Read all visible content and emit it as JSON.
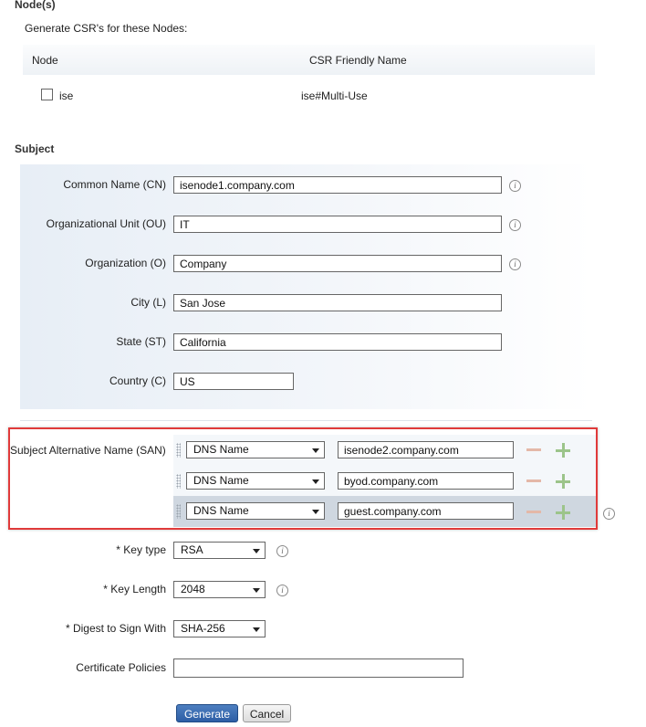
{
  "nodes": {
    "title": "Node(s)",
    "subtitle": "Generate CSR's for these Nodes:",
    "columns": [
      "Node",
      "CSR Friendly Name"
    ],
    "rows": [
      {
        "node": "ise",
        "friendly_name": "ise#Multi-Use",
        "checked": false
      }
    ]
  },
  "subject": {
    "title": "Subject",
    "fields": [
      {
        "label": "Common Name (CN)",
        "value": "isenode1.company.com",
        "info": true
      },
      {
        "label": "Organizational Unit (OU)",
        "value": "IT",
        "info": true
      },
      {
        "label": "Organization (O)",
        "value": "Company",
        "info": true
      },
      {
        "label": "City (L)",
        "value": "San Jose",
        "info": false
      },
      {
        "label": "State (ST)",
        "value": "California",
        "info": false
      },
      {
        "label": "Country (C)",
        "value": "US",
        "info": false
      }
    ]
  },
  "san": {
    "label": "Subject Alternative Name (SAN)",
    "rows": [
      {
        "type": "DNS Name",
        "value": "isenode2.company.com"
      },
      {
        "type": "DNS Name",
        "value": "byod.company.com"
      },
      {
        "type": "DNS Name",
        "value": "guest.company.com"
      }
    ],
    "highlight_color": "#e03a3a"
  },
  "key_type": {
    "label": "* Key type",
    "value": "RSA"
  },
  "key_length": {
    "label": "* Key Length",
    "value": "2048"
  },
  "digest": {
    "label": "* Digest to Sign With",
    "value": "SHA-256"
  },
  "cert_policies": {
    "label": "Certificate Policies",
    "value": ""
  },
  "buttons": {
    "generate": "Generate",
    "cancel": "Cancel"
  },
  "icons": {
    "info": "info-icon",
    "add": "plus-icon",
    "remove": "minus-icon",
    "grip": "drag-handle-icon"
  },
  "colors": {
    "primary_button": "#2d5ea5",
    "highlight": "#e03a3a"
  }
}
